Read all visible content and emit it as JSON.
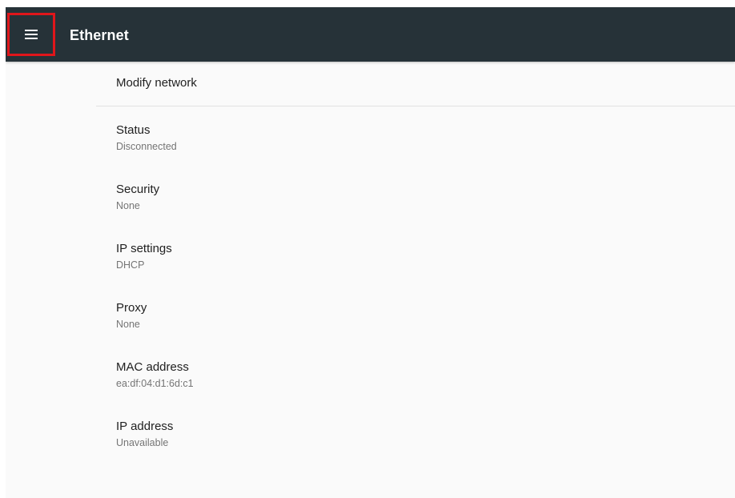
{
  "toolbar": {
    "title": "Ethernet",
    "menu_icon": "hamburger-menu-icon"
  },
  "modify": {
    "label": "Modify network"
  },
  "prefs": [
    {
      "title": "Status",
      "summary": "Disconnected"
    },
    {
      "title": "Security",
      "summary": "None"
    },
    {
      "title": "IP settings",
      "summary": "DHCP"
    },
    {
      "title": "Proxy",
      "summary": "None"
    },
    {
      "title": "MAC address",
      "summary": "ea:df:04:d1:6d:c1"
    },
    {
      "title": "IP address",
      "summary": "Unavailable"
    }
  ],
  "colors": {
    "toolbar_bg": "#263238",
    "highlight_border": "#e0161b",
    "content_bg": "#fafafa",
    "primary_text": "#212121",
    "secondary_text": "#757575"
  }
}
